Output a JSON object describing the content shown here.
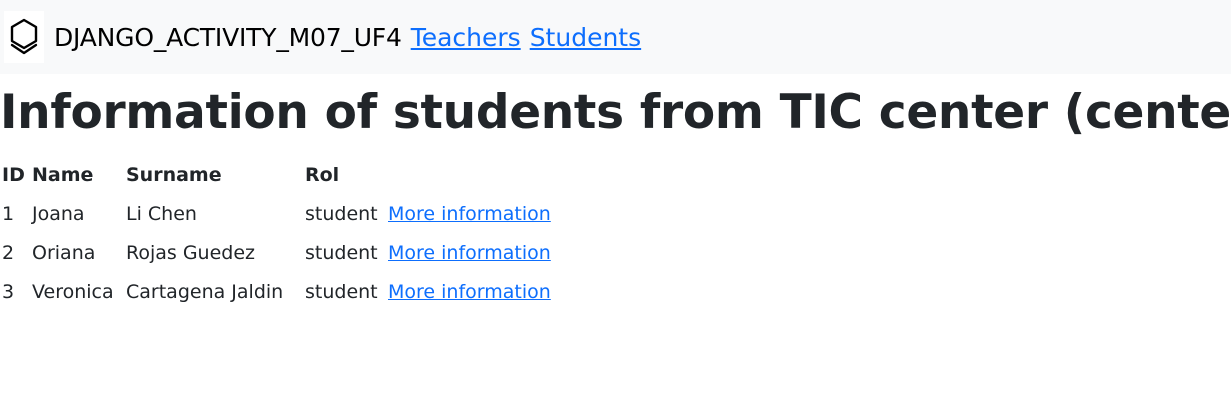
{
  "navbar": {
    "brand": "DJANGO_ACTIVITY_M07_UF4",
    "links": [
      {
        "label": "Teachers"
      },
      {
        "label": "Students"
      }
    ],
    "logo_icon": "hexagon-shield-icon"
  },
  "page_title": "Information of students from TIC center (center)",
  "table": {
    "headers": [
      "ID",
      "Name",
      "Surname",
      "Rol"
    ],
    "rows": [
      {
        "id": "1",
        "name": "Joana",
        "surname": "Li Chen",
        "rol": "student",
        "link": "More information"
      },
      {
        "id": "2",
        "name": "Oriana",
        "surname": "Rojas Guedez",
        "rol": "student",
        "link": "More information"
      },
      {
        "id": "3",
        "name": "Veronica",
        "surname": "Cartagena Jaldin",
        "rol": "student",
        "link": "More information"
      }
    ]
  },
  "colors": {
    "link": "#0d6efd",
    "navbar_bg": "#f8f9fa",
    "text": "#212529"
  }
}
